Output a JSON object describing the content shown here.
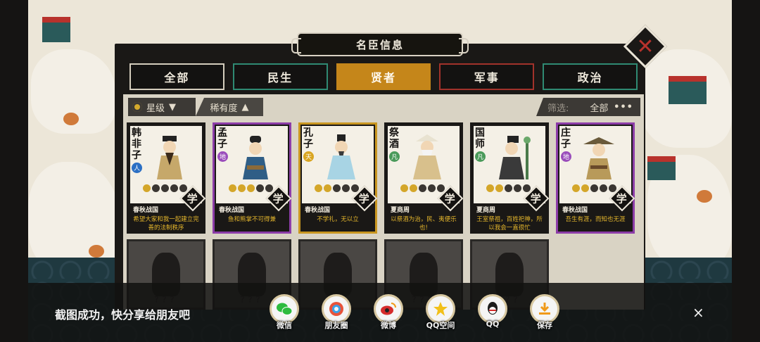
{
  "dialog": {
    "title": "名臣信息"
  },
  "tabs": [
    {
      "label": "全部"
    },
    {
      "label": "民生"
    },
    {
      "label": "贤者",
      "active": true
    },
    {
      "label": "军事"
    },
    {
      "label": "政治"
    }
  ],
  "filters": {
    "star_sort": "星级",
    "rarity_sort": "稀有度",
    "filter_label": "筛选:",
    "filter_value": "全部"
  },
  "cards": [
    {
      "name": "韩非子",
      "grade": "人",
      "grade_type": "ren",
      "stars": 0,
      "era": "春秋战国",
      "badge": "学",
      "quote": "希望大家和我一起建立完善的法制秩序",
      "rarity": "none"
    },
    {
      "name": "孟子",
      "grade": "地",
      "grade_type": "di",
      "stars": 2,
      "era": "春秋战国",
      "badge": "学",
      "quote": "鱼和熊掌不可得兼",
      "rarity": "purple"
    },
    {
      "name": "孔子",
      "grade": "天",
      "grade_type": "tian",
      "stars": 1,
      "era": "春秋战国",
      "badge": "学",
      "quote": "不学礼，无以立",
      "rarity": "gold"
    },
    {
      "name": "祭酒",
      "grade": "凡",
      "grade_type": "fan",
      "stars": 1,
      "era": "夏商周",
      "badge": "学",
      "quote": "以祭酒为治，民、夷便乐也!",
      "rarity": "none"
    },
    {
      "name": "国师",
      "grade": "凡",
      "grade_type": "fan",
      "stars": 1,
      "era": "夏商周",
      "badge": "学",
      "quote": "王室祭祖，百姓祀神，所以我会一直很忙",
      "rarity": "none"
    },
    {
      "name": "庄子",
      "grade": "地",
      "grade_type": "di",
      "stars": 1,
      "era": "春秋战国",
      "badge": "学",
      "quote": "吾生有涯，而知也无涯",
      "rarity": "purple"
    }
  ],
  "locked": [
    {
      "label": "？？？"
    },
    {
      "label": "？？？"
    },
    {
      "label": "？？？"
    },
    {
      "label": "？？？"
    },
    {
      "label": "？？？"
    }
  ],
  "share": {
    "message": "截图成功，快分享给朋友吧",
    "items": [
      {
        "label": "微信",
        "icon": "wechat-icon",
        "color": "#2dbb3f"
      },
      {
        "label": "朋友圈",
        "icon": "moments-icon",
        "color": "#e8533a"
      },
      {
        "label": "微博",
        "icon": "weibo-icon",
        "color": "#d62b2b"
      },
      {
        "label": "QQ空间",
        "icon": "qzone-icon",
        "color": "#f2c019"
      },
      {
        "label": "QQ",
        "icon": "qq-icon",
        "color": "#1c1c1c"
      },
      {
        "label": "保存",
        "icon": "save-icon",
        "color": "#f09a1a"
      }
    ],
    "close": "×"
  }
}
